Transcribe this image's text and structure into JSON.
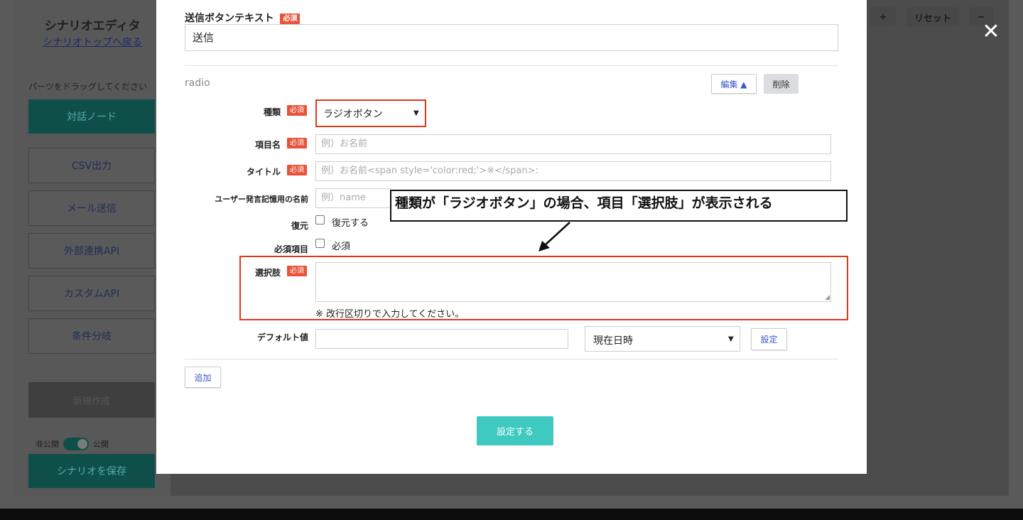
{
  "background": {
    "sidebar": {
      "title": "シナリオエディタ",
      "back_link": "シナリオトップへ戻る",
      "drag_hint": "パーツをドラッグしてください",
      "dialog_node": "対話ノード",
      "parts": [
        "CSV出力",
        "メール送信",
        "外部連携API",
        "カスタムAPI",
        "条件分岐"
      ],
      "dark_button": "新規作成",
      "toggle_off_label": "非公開",
      "toggle_on_label": "公開",
      "save_button": "シナリオを保存"
    },
    "toolbar": {
      "plus": "+",
      "reset": "リセット",
      "minus": "−"
    }
  },
  "modal": {
    "close_icon": "✕",
    "submit_text": {
      "label": "送信ボタンテキスト",
      "required": "必須",
      "value": "送信"
    },
    "item": {
      "type_name": "radio",
      "edit_button": "編集 ▲",
      "delete_button": "削除",
      "fields": {
        "kind": {
          "label": "種類",
          "required": "必須",
          "value": "ラジオボタン"
        },
        "item_name": {
          "label": "項目名",
          "required": "必須",
          "placeholder": "例）お名前"
        },
        "title": {
          "label": "タイトル",
          "required": "必須",
          "placeholder": "例）お名前<span style='color:red;'>※</span>:"
        },
        "memory_name": {
          "label": "ユーザー発言記憶用の名前",
          "placeholder": "例）name"
        },
        "restore": {
          "label": "復元",
          "checkbox_label": "復元する"
        },
        "required_item": {
          "label": "必須項目",
          "checkbox_label": "必須"
        },
        "choices": {
          "label": "選択肢",
          "required": "必須",
          "note": "※ 改行区切りで入力してください。"
        },
        "default_value": {
          "label": "デフォルト値",
          "select_value": "現在日時",
          "set_button": "設定"
        }
      }
    },
    "add_button": "追加",
    "submit_button": "設定する"
  },
  "annotation": {
    "callout": "種類が「ラジオボタン」の場合、項目「選択肢」が表示される"
  },
  "colors": {
    "required_badge": "#e8533a",
    "highlight": "#e0391a",
    "primary": "#3ecac0",
    "link_blue": "#3a55c8"
  }
}
